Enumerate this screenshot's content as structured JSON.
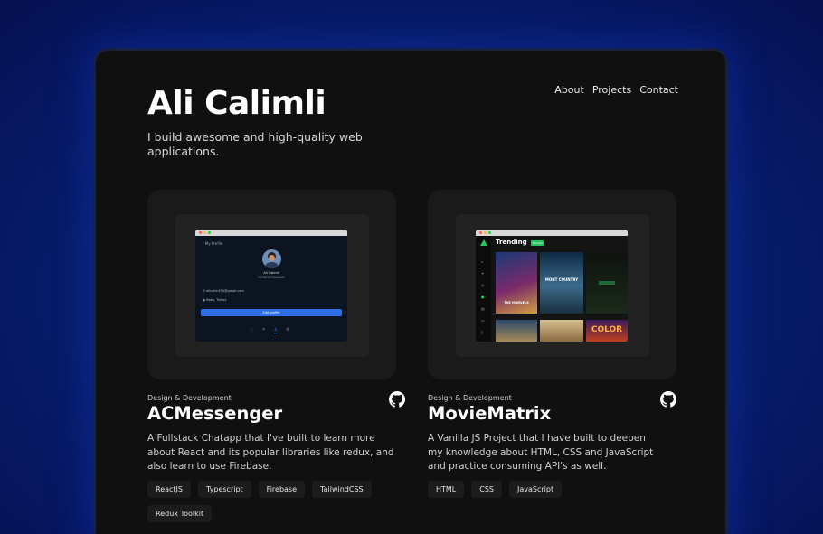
{
  "header": {
    "name": "Ali Calimli",
    "tagline": "I build awesome and high-quality web applications."
  },
  "nav": {
    "items": [
      "About",
      "Projects",
      "Contact"
    ]
  },
  "projects": [
    {
      "category": "Design & Development",
      "title": "ACMessenger",
      "description": "A Fullstack Chatapp that I've built to learn more about React and its popular libraries like redux, and also learn to use Firebase.",
      "tags": [
        "ReactJS",
        "Typescript",
        "Firebase",
        "TailwindCSS",
        "Redux Toolkit"
      ],
      "preview": {
        "back": "My Profile",
        "user_name": "Ali Calimli",
        "user_sub": "Frontend Developer",
        "email": "alicalimli74@gmail.com",
        "location": "Baku, Turkey",
        "button": "Edit profile"
      }
    },
    {
      "category": "Design & Development",
      "title": "MovieMatrix",
      "description": "A Vanilla JS Project that I have built to deepen my knowledge about HTML, CSS and JavaScript and practice consuming API's as well.",
      "tags": [
        "HTML",
        "CSS",
        "JavaScript"
      ],
      "preview": {
        "heading": "Trending",
        "badge": "Movies",
        "posters": [
          "THE MARVELS",
          "MONT COUNTRY",
          "",
          "",
          "",
          "COLOR"
        ]
      }
    }
  ],
  "icons": {
    "repo": "github-icon"
  },
  "colors": {
    "accent_blue": "#2f6fe8",
    "accent_green": "#22c55e"
  }
}
